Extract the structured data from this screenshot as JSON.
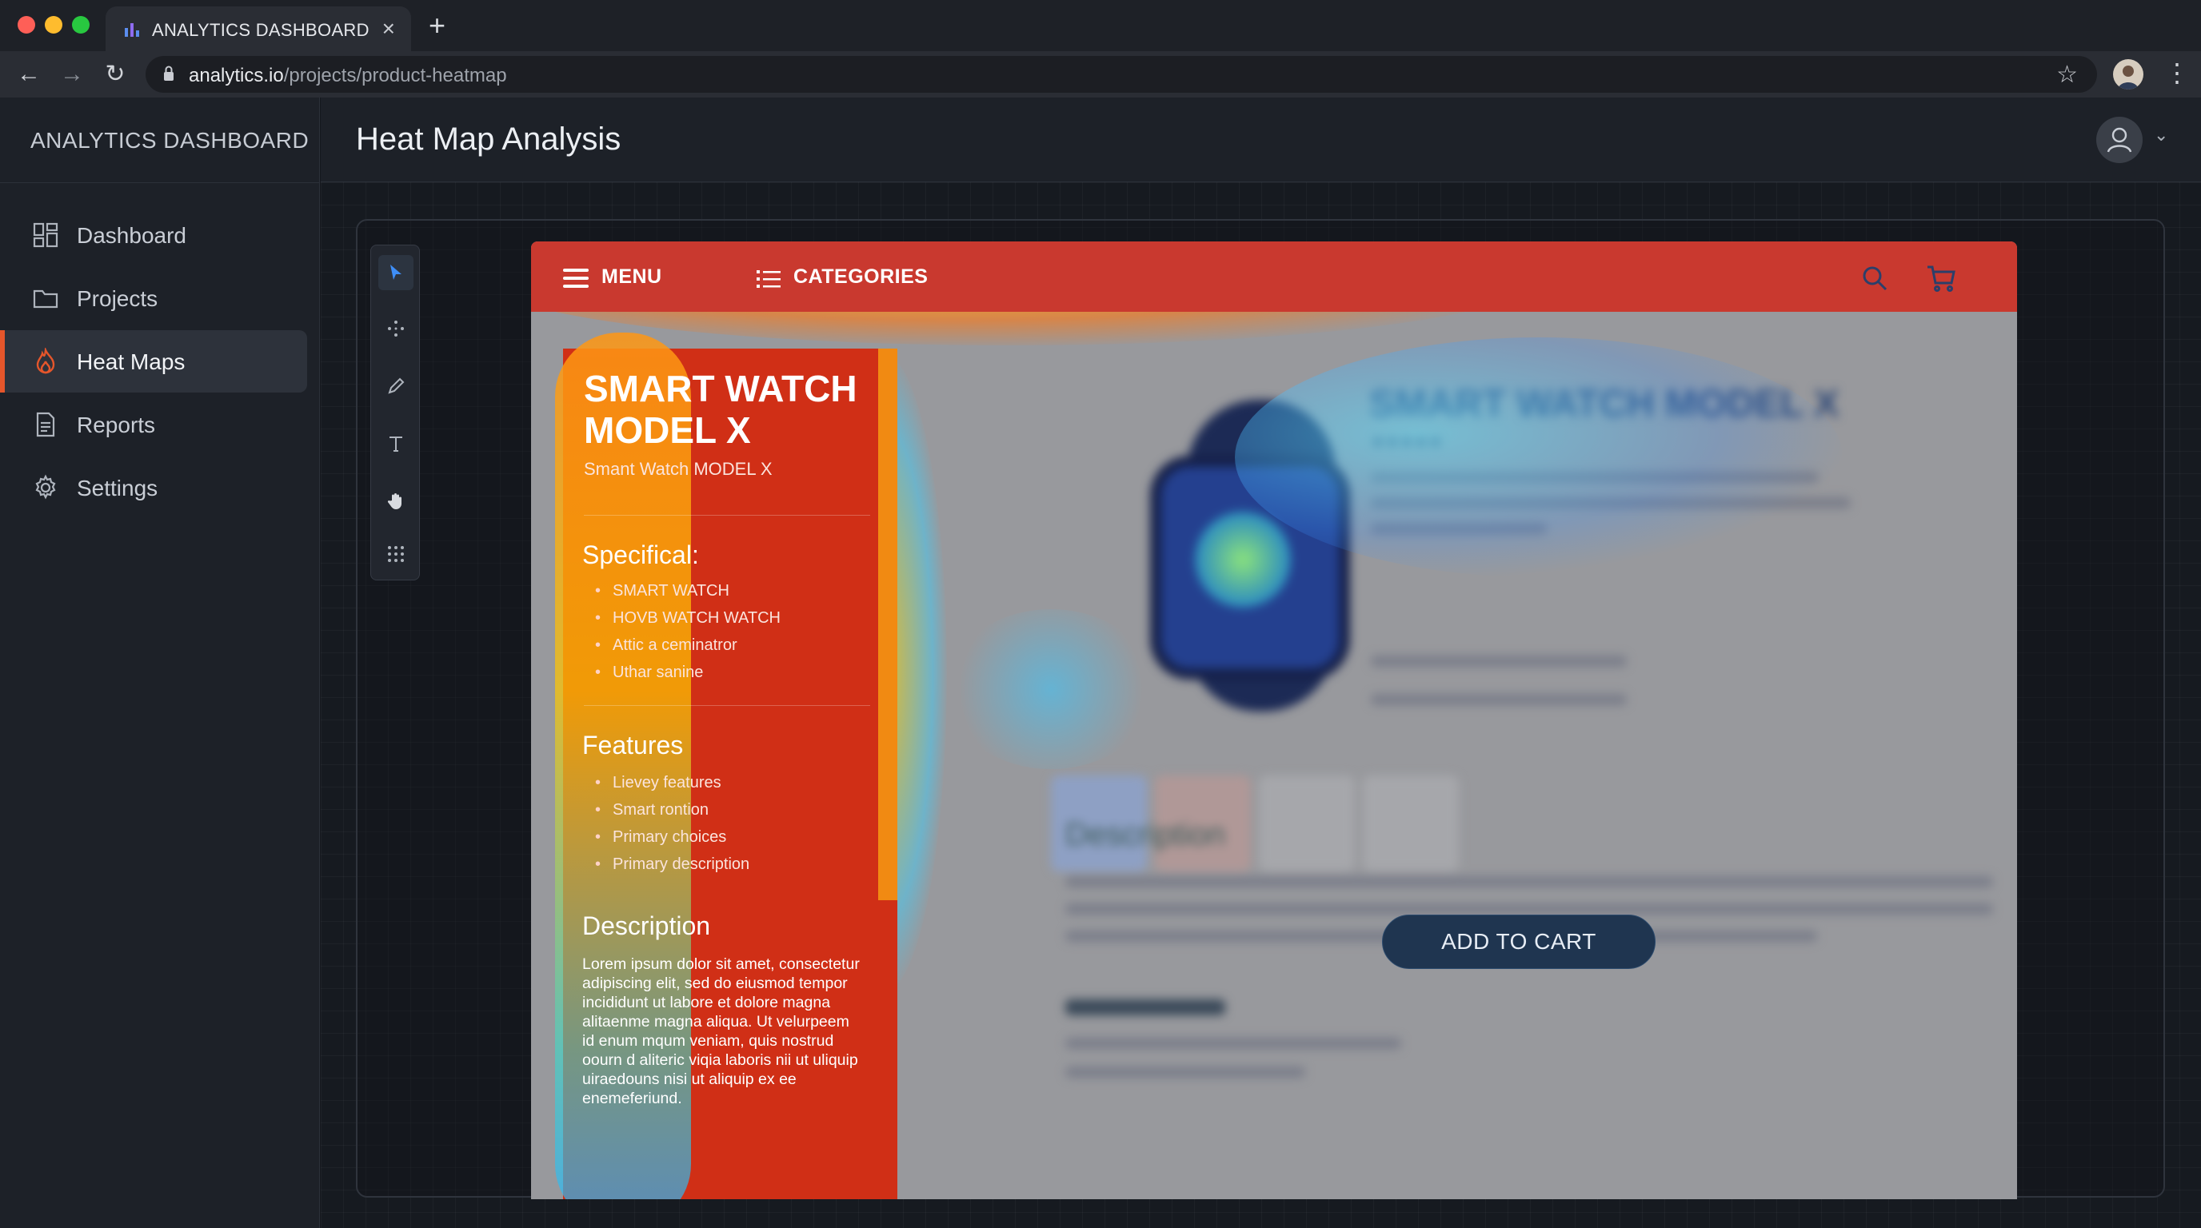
{
  "browser": {
    "tab_title": "ANALYTICS DASHBOARD",
    "url_host": "analytics.io",
    "url_path": "/projects/product-heatmap"
  },
  "sidebar": {
    "brand": "ANALYTICS DASHBOARD",
    "items": [
      {
        "label": "Dashboard",
        "icon": "dashboard-grid-icon"
      },
      {
        "label": "Projects",
        "icon": "folder-icon"
      },
      {
        "label": "Heat Maps",
        "icon": "flame-icon",
        "active": true
      },
      {
        "label": "Reports",
        "icon": "document-icon"
      },
      {
        "label": "Settings",
        "icon": "gear-icon"
      }
    ]
  },
  "header": {
    "title": "Heat Map Analysis"
  },
  "tools": [
    "pointer-icon",
    "move-icon",
    "pencil-icon",
    "text-icon",
    "hand-icon",
    "grid-icon"
  ],
  "preview": {
    "nav": {
      "menu_label": "MENU",
      "categories_label": "CATEGORIES"
    },
    "spec_panel": {
      "title": "SMART WATCH MODEL X",
      "subtitle": "Smant Watch MODEL X",
      "specs_heading": "Specifical:",
      "specs": [
        "SMART WATCH",
        "HOVB WATCH WATCH",
        "Attic a ceminatror",
        "Uthar sanine"
      ],
      "features_heading": "Features",
      "features": [
        "Lievey features",
        "Smart rontion",
        "Primary choices",
        "Primary description"
      ],
      "description_heading": "Description",
      "description": "Lorem ipsum dolor sit amet, consectetur adipiscing elit, sed do eiusmod tempor incididunt ut labore et dolore magna alitaenme magna aliqua. Ut velurpeem id enum mqum veniam, quis nostrud oourn d aliteric viqia laboris nii ut uliquip uiraedouns nisi ut aliquip ex ee enemeferiund."
    },
    "product": {
      "title": "SMART WATCH MODEL X",
      "add_to_cart": "ADD TO CART"
    }
  },
  "colors": {
    "accent": "#e5562b",
    "nav_red": "#c9392f",
    "panel_red": "#d02f16",
    "cart_button": "#1f3550"
  }
}
